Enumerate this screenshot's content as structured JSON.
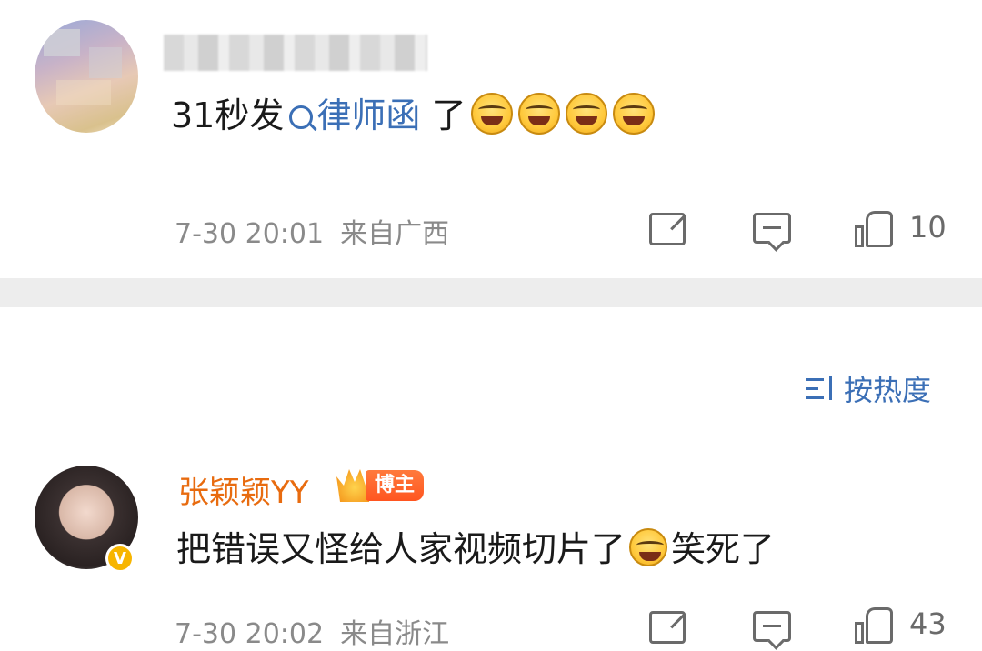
{
  "comment1": {
    "text_before": "31秒发",
    "link_text": "律师函",
    "text_after": " 了",
    "emoji_count": 4,
    "time": "7-30 20:01",
    "location": "来自广西",
    "likes": "10"
  },
  "sort": {
    "label": "按热度"
  },
  "comment2": {
    "username": "张颖颖YY",
    "badge": "博主",
    "verified_mark": "V",
    "text_before": "把错误又怪给人家视频切片了",
    "text_after": "笑死了",
    "time": "7-30 20:02",
    "location": "来自浙江",
    "likes": "43"
  },
  "colors": {
    "link": "#3b6fb6",
    "username": "#e86b0f",
    "meta": "#8a8a8a",
    "divider": "#ededed"
  }
}
